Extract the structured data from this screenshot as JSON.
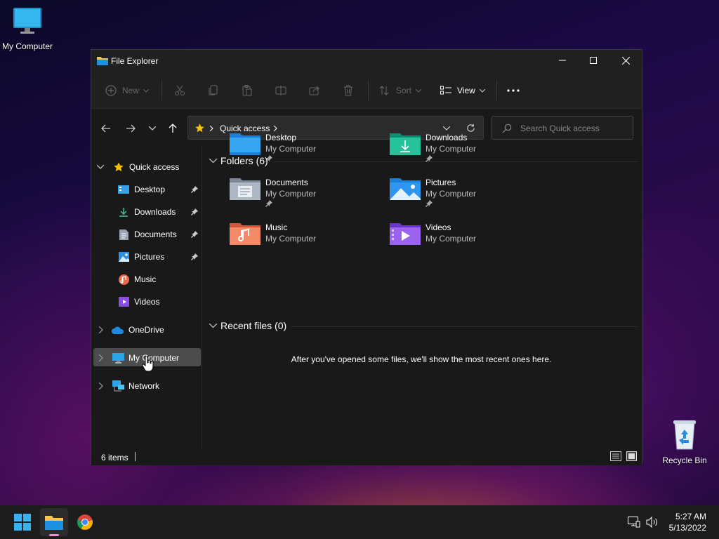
{
  "desktop": {
    "icons": [
      {
        "label": "My Computer"
      },
      {
        "label": "Recycle Bin"
      }
    ]
  },
  "window": {
    "title": "File Explorer",
    "toolbar": {
      "new_label": "New",
      "sort_label": "Sort",
      "view_label": "View"
    },
    "address": {
      "crumb": "Quick access"
    },
    "search": {
      "placeholder": "Search Quick access"
    },
    "sidebar": {
      "quick_access": "Quick access",
      "pinned": [
        "Desktop",
        "Downloads",
        "Documents",
        "Pictures"
      ],
      "unpinned": [
        "Music",
        "Videos"
      ],
      "onedrive": "OneDrive",
      "mycomputer": "My Computer",
      "network": "Network"
    },
    "folders_header": "Folders (6)",
    "folders": [
      {
        "name": "Desktop",
        "location": "My Computer",
        "pinned": true
      },
      {
        "name": "Downloads",
        "location": "My Computer",
        "pinned": true
      },
      {
        "name": "Documents",
        "location": "My Computer",
        "pinned": true
      },
      {
        "name": "Pictures",
        "location": "My Computer",
        "pinned": true
      },
      {
        "name": "Music",
        "location": "My Computer",
        "pinned": false
      },
      {
        "name": "Videos",
        "location": "My Computer",
        "pinned": false
      }
    ],
    "recent_header": "Recent files (0)",
    "recent_empty": "After you've opened some files, we'll show the most recent ones here.",
    "status": {
      "count": "6 items"
    }
  },
  "taskbar": {
    "time": "5:27 AM",
    "date": "5/13/2022"
  },
  "colors": {
    "window_bg": "#191919",
    "selection": "#4c4c4c",
    "accent_blue": "#0078d4",
    "folder_yellow": "#f5c84c"
  }
}
